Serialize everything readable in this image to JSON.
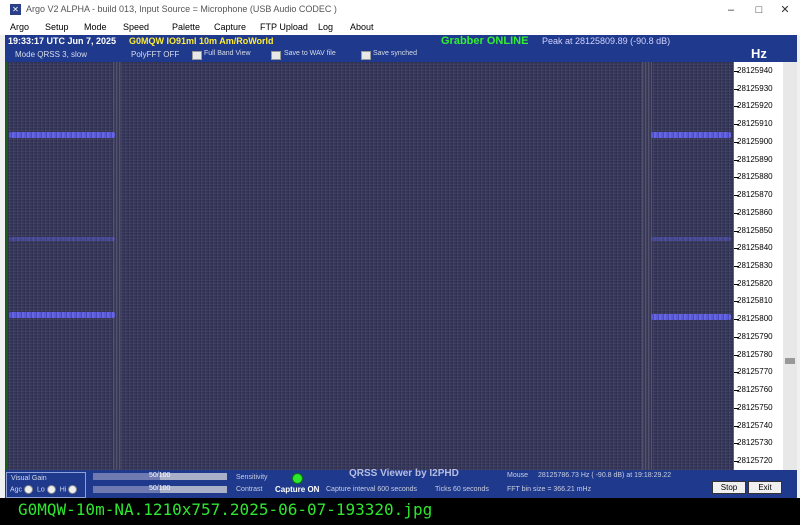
{
  "window": {
    "title": "Argo V2 ALPHA - build 013, Input Source = Microphone (USB Audio CODEC )",
    "controls": [
      "minimize-icon",
      "maximize-icon",
      "close-icon"
    ]
  },
  "menu": [
    "Argo",
    "Setup",
    "Mode",
    "Speed",
    "Palette",
    "Capture",
    "FTP Upload",
    "Log",
    "About"
  ],
  "header": {
    "time": "19:33:17 UTC   Jun 7, 2025",
    "callsign": "G0MQW IO91ml 10m Am/RoWorld",
    "grabber_status": "Grabber ONLINE",
    "peak": "Peak at 28125809.89 (-90.8 dB)"
  },
  "toolbar": {
    "mode": "Mode   QRSS 3, slow",
    "polyfft": "PolyFFT OFF",
    "full_band_view": "Full Band View",
    "save_wav": "Save to WAV file",
    "save_synched": "Save synched",
    "unit": "Hz"
  },
  "scale": {
    "labels": [
      "28125940",
      "28125930",
      "28125920",
      "28125910",
      "28125900",
      "28125890",
      "28125880",
      "28125870",
      "28125860",
      "28125850",
      "28125840",
      "28125830",
      "28125820",
      "28125810",
      "28125800",
      "28125790",
      "28125780",
      "28125770",
      "28125760",
      "28125750",
      "28125740",
      "28125730",
      "28125720"
    ]
  },
  "bottom": {
    "visual_gain": "Visual Gain",
    "agc": "Agc",
    "lo": "Lo",
    "hi": "Hi",
    "gain_value": "50/100",
    "contrast_value": "50/100",
    "gain_level": 0.5,
    "contrast_level": 0.5,
    "sensitivity": "Sensitivity",
    "contrast": "Contrast",
    "capture": "Capture ON",
    "viewer": "QRSS Viewer by I2PHD",
    "capture_interval": "Capture interval 600 seconds",
    "ticks": "Ticks 60 seconds",
    "mouse_label": "Mouse",
    "mouse_value": "28125786.73 Hz  ( -90.8 dB) at 19:18:29.22",
    "fft_bin": "FFT bin size = 366.21 mHz",
    "stop": "Stop",
    "exit": "Exit"
  },
  "banner": "G0MQW-10m-NA.1210x757.2025-06-07-193320.jpg",
  "colors": {
    "panel": "#1f3a8c",
    "waterfall": "#35365a",
    "trace": "#5a5ad8",
    "grabber": "#33ee33",
    "callsign": "#ffee33",
    "banner_text": "#2ee62e"
  }
}
